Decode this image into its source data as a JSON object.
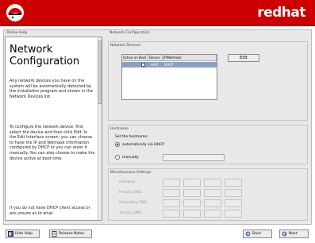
{
  "banner": {
    "brand": "redhat"
  },
  "help": {
    "panel_label": "Online Help",
    "title_line1": "Network",
    "title_line2": "Configuration",
    "p1": "Any network devices you have on the system will be automatically detected by the installation program and shown in the Network Devices list.",
    "p2": "To configure the network device, first select the device and then click Edit. In the Edit Interface screen, you can choose to have the IP and Netmask information configured by DHCP or you can enter it manually. You can also choose to make the device active at boot time.",
    "p3": "If you do not have DHCP client access or are unsure as to what"
  },
  "main": {
    "section_title": "Network Configuration",
    "devices_label": "Network Devices",
    "columns": [
      "Active on Boot",
      "Device",
      "IP/Netmask"
    ],
    "rows": [
      {
        "active": true,
        "device": "eth0",
        "ip": "DHCP"
      }
    ],
    "edit_label": "Edit",
    "hostname_section": "Hostname",
    "hostname_prompt": "Set the hostname:",
    "auto_label": "automatically via DHCP",
    "manual_label": "manually",
    "manual_selected": false,
    "misc_label": "Miscellaneous Settings",
    "misc_fields": [
      "Gateway:",
      "Primary DNS:",
      "Secondary DNS:",
      "Tertiary DNS:"
    ]
  },
  "footer": {
    "hide_help": "Hide Help",
    "release_notes": "Release Notes",
    "back": "Back",
    "next": "Next"
  },
  "colors": {
    "banner": "#cc0000",
    "selection": "#8aa0c8"
  }
}
